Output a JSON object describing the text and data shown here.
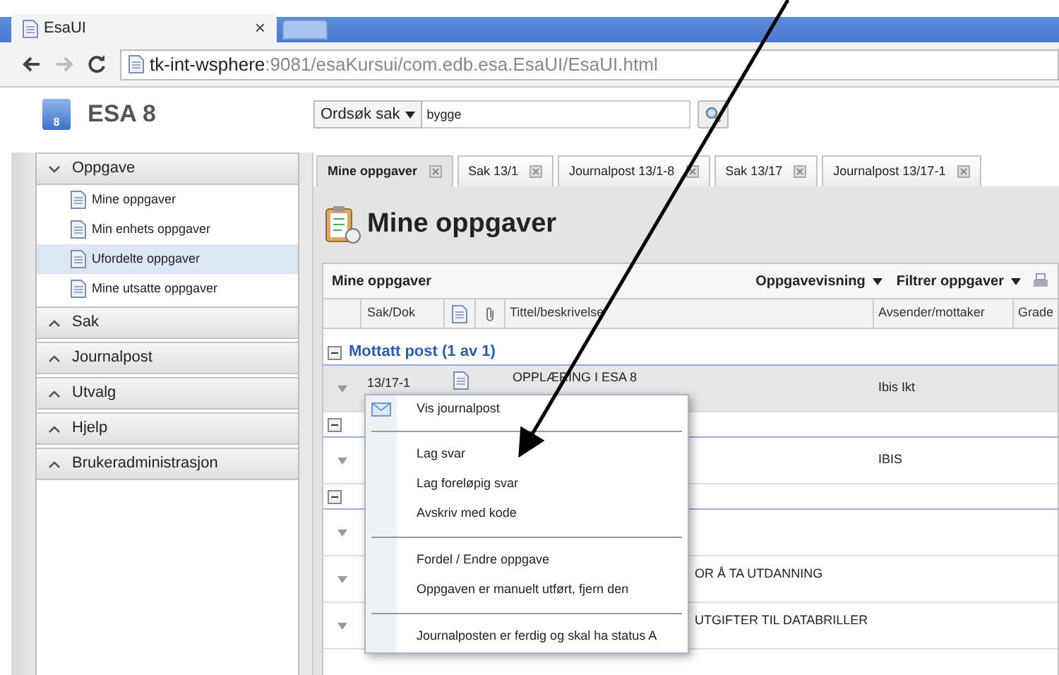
{
  "browser": {
    "tab_title": "EsaUI",
    "close": "×",
    "url_host": "tk-int-wsphere",
    "url_path": ":9081/esaKursui/com.edb.esa.EsaUI/EsaUI.html"
  },
  "app": {
    "title": "ESA 8",
    "logo_digit": "8",
    "search": {
      "scope": "Ordsøk sak",
      "value": "bygge"
    }
  },
  "sidebar": [
    {
      "label": "Oppgave",
      "expanded": true,
      "items": [
        {
          "label": "Mine oppgaver",
          "selected": false
        },
        {
          "label": "Min enhets oppgaver",
          "selected": false
        },
        {
          "label": "Ufordelte oppgaver",
          "selected": true
        },
        {
          "label": "Mine utsatte oppgaver",
          "selected": false
        }
      ]
    },
    {
      "label": "Sak",
      "expanded": false
    },
    {
      "label": "Journalpost",
      "expanded": false
    },
    {
      "label": "Utvalg",
      "expanded": false
    },
    {
      "label": "Hjelp",
      "expanded": false
    },
    {
      "label": "Brukeradministrasjon",
      "expanded": false
    }
  ],
  "tabs": [
    {
      "label": "Mine oppgaver",
      "selected": true
    },
    {
      "label": "Sak 13/1",
      "selected": false
    },
    {
      "label": "Journalpost 13/1-8",
      "selected": false
    },
    {
      "label": "Sak 13/17",
      "selected": false
    },
    {
      "label": "Journalpost 13/17-1",
      "selected": false
    }
  ],
  "page_title": "Mine oppgaver",
  "grid": {
    "title": "Mine oppgaver",
    "actions": [
      "Oppgavevisning",
      "Filtrer oppgaver"
    ],
    "columns": [
      "Sak/Dok",
      "Tittel/beskrivelse",
      "Avsender/mottaker",
      "Grade"
    ],
    "rows": [
      {
        "kind": "group",
        "label": "Mottatt post (1 av 1)"
      },
      {
        "kind": "item",
        "sak": "13/17-1",
        "title": "OPPLÆRING I ESA 8",
        "sender": "Ibis Ikt",
        "selected": true
      },
      {
        "kind": "group"
      },
      {
        "kind": "item",
        "sender": "IBIS",
        "selected": false
      },
      {
        "kind": "group"
      },
      {
        "kind": "item",
        "selected": false
      },
      {
        "kind": "clipped",
        "title": "OR Å TA UTDANNING",
        "selected": false
      },
      {
        "kind": "clipped",
        "title": "UTGIFTER TIL DATABRILLER",
        "selected": false
      }
    ]
  },
  "context_menu": [
    {
      "kind": "icon_item",
      "label": "Vis journalpost"
    },
    {
      "kind": "separator"
    },
    {
      "kind": "item",
      "label": "Lag svar"
    },
    {
      "kind": "item",
      "label": "Lag foreløpig svar"
    },
    {
      "kind": "item",
      "label": "Avskriv med kode"
    },
    {
      "kind": "separator"
    },
    {
      "kind": "item",
      "label": "Fordel / Endre oppgave"
    },
    {
      "kind": "item",
      "label": "Oppgaven er manuelt utført, fjern den"
    },
    {
      "kind": "separator"
    },
    {
      "kind": "item",
      "label": "Journalposten er ferdig og skal ha status A"
    }
  ]
}
